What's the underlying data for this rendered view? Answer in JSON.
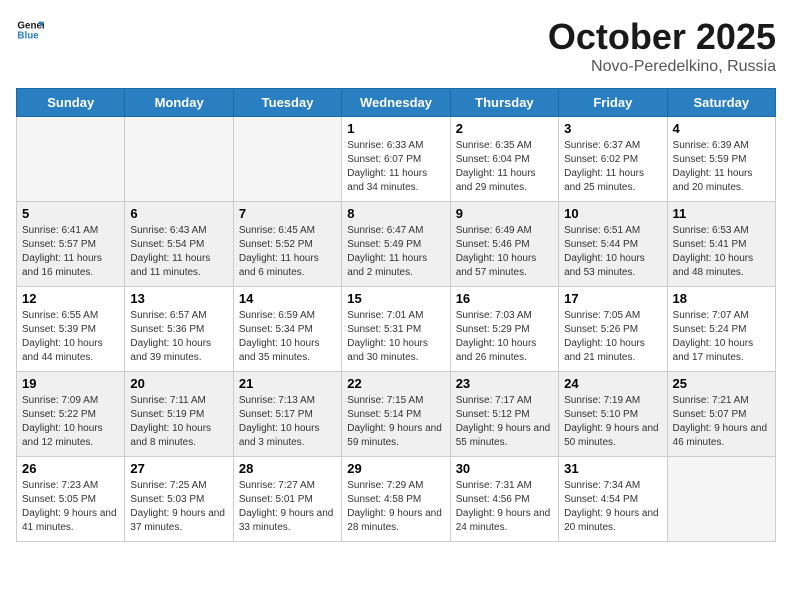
{
  "logo": {
    "line1": "General",
    "line2": "Blue"
  },
  "title": "October 2025",
  "subtitle": "Novo-Peredelkino, Russia",
  "weekdays": [
    "Sunday",
    "Monday",
    "Tuesday",
    "Wednesday",
    "Thursday",
    "Friday",
    "Saturday"
  ],
  "weeks": [
    [
      {
        "day": "",
        "info": ""
      },
      {
        "day": "",
        "info": ""
      },
      {
        "day": "",
        "info": ""
      },
      {
        "day": "1",
        "info": "Sunrise: 6:33 AM\nSunset: 6:07 PM\nDaylight: 11 hours\nand 34 minutes."
      },
      {
        "day": "2",
        "info": "Sunrise: 6:35 AM\nSunset: 6:04 PM\nDaylight: 11 hours\nand 29 minutes."
      },
      {
        "day": "3",
        "info": "Sunrise: 6:37 AM\nSunset: 6:02 PM\nDaylight: 11 hours\nand 25 minutes."
      },
      {
        "day": "4",
        "info": "Sunrise: 6:39 AM\nSunset: 5:59 PM\nDaylight: 11 hours\nand 20 minutes."
      }
    ],
    [
      {
        "day": "5",
        "info": "Sunrise: 6:41 AM\nSunset: 5:57 PM\nDaylight: 11 hours\nand 16 minutes."
      },
      {
        "day": "6",
        "info": "Sunrise: 6:43 AM\nSunset: 5:54 PM\nDaylight: 11 hours\nand 11 minutes."
      },
      {
        "day": "7",
        "info": "Sunrise: 6:45 AM\nSunset: 5:52 PM\nDaylight: 11 hours\nand 6 minutes."
      },
      {
        "day": "8",
        "info": "Sunrise: 6:47 AM\nSunset: 5:49 PM\nDaylight: 11 hours\nand 2 minutes."
      },
      {
        "day": "9",
        "info": "Sunrise: 6:49 AM\nSunset: 5:46 PM\nDaylight: 10 hours\nand 57 minutes."
      },
      {
        "day": "10",
        "info": "Sunrise: 6:51 AM\nSunset: 5:44 PM\nDaylight: 10 hours\nand 53 minutes."
      },
      {
        "day": "11",
        "info": "Sunrise: 6:53 AM\nSunset: 5:41 PM\nDaylight: 10 hours\nand 48 minutes."
      }
    ],
    [
      {
        "day": "12",
        "info": "Sunrise: 6:55 AM\nSunset: 5:39 PM\nDaylight: 10 hours\nand 44 minutes."
      },
      {
        "day": "13",
        "info": "Sunrise: 6:57 AM\nSunset: 5:36 PM\nDaylight: 10 hours\nand 39 minutes."
      },
      {
        "day": "14",
        "info": "Sunrise: 6:59 AM\nSunset: 5:34 PM\nDaylight: 10 hours\nand 35 minutes."
      },
      {
        "day": "15",
        "info": "Sunrise: 7:01 AM\nSunset: 5:31 PM\nDaylight: 10 hours\nand 30 minutes."
      },
      {
        "day": "16",
        "info": "Sunrise: 7:03 AM\nSunset: 5:29 PM\nDaylight: 10 hours\nand 26 minutes."
      },
      {
        "day": "17",
        "info": "Sunrise: 7:05 AM\nSunset: 5:26 PM\nDaylight: 10 hours\nand 21 minutes."
      },
      {
        "day": "18",
        "info": "Sunrise: 7:07 AM\nSunset: 5:24 PM\nDaylight: 10 hours\nand 17 minutes."
      }
    ],
    [
      {
        "day": "19",
        "info": "Sunrise: 7:09 AM\nSunset: 5:22 PM\nDaylight: 10 hours\nand 12 minutes."
      },
      {
        "day": "20",
        "info": "Sunrise: 7:11 AM\nSunset: 5:19 PM\nDaylight: 10 hours\nand 8 minutes."
      },
      {
        "day": "21",
        "info": "Sunrise: 7:13 AM\nSunset: 5:17 PM\nDaylight: 10 hours\nand 3 minutes."
      },
      {
        "day": "22",
        "info": "Sunrise: 7:15 AM\nSunset: 5:14 PM\nDaylight: 9 hours\nand 59 minutes."
      },
      {
        "day": "23",
        "info": "Sunrise: 7:17 AM\nSunset: 5:12 PM\nDaylight: 9 hours\nand 55 minutes."
      },
      {
        "day": "24",
        "info": "Sunrise: 7:19 AM\nSunset: 5:10 PM\nDaylight: 9 hours\nand 50 minutes."
      },
      {
        "day": "25",
        "info": "Sunrise: 7:21 AM\nSunset: 5:07 PM\nDaylight: 9 hours\nand 46 minutes."
      }
    ],
    [
      {
        "day": "26",
        "info": "Sunrise: 7:23 AM\nSunset: 5:05 PM\nDaylight: 9 hours\nand 41 minutes."
      },
      {
        "day": "27",
        "info": "Sunrise: 7:25 AM\nSunset: 5:03 PM\nDaylight: 9 hours\nand 37 minutes."
      },
      {
        "day": "28",
        "info": "Sunrise: 7:27 AM\nSunset: 5:01 PM\nDaylight: 9 hours\nand 33 minutes."
      },
      {
        "day": "29",
        "info": "Sunrise: 7:29 AM\nSunset: 4:58 PM\nDaylight: 9 hours\nand 28 minutes."
      },
      {
        "day": "30",
        "info": "Sunrise: 7:31 AM\nSunset: 4:56 PM\nDaylight: 9 hours\nand 24 minutes."
      },
      {
        "day": "31",
        "info": "Sunrise: 7:34 AM\nSunset: 4:54 PM\nDaylight: 9 hours\nand 20 minutes."
      },
      {
        "day": "",
        "info": ""
      }
    ]
  ]
}
